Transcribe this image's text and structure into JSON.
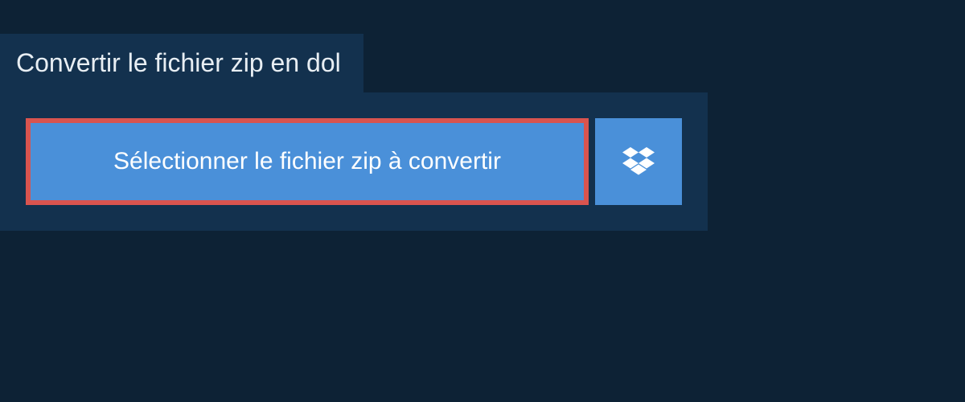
{
  "tab": {
    "title": "Convertir le fichier zip en dol"
  },
  "actions": {
    "select_file_label": "Sélectionner le fichier zip à convertir",
    "dropbox_icon": "dropbox"
  },
  "colors": {
    "background": "#0d2235",
    "panel": "#13314e",
    "button": "#4a90d9",
    "highlight_border": "#d9544f",
    "text_light": "#e8eef3",
    "text_white": "#ffffff"
  }
}
